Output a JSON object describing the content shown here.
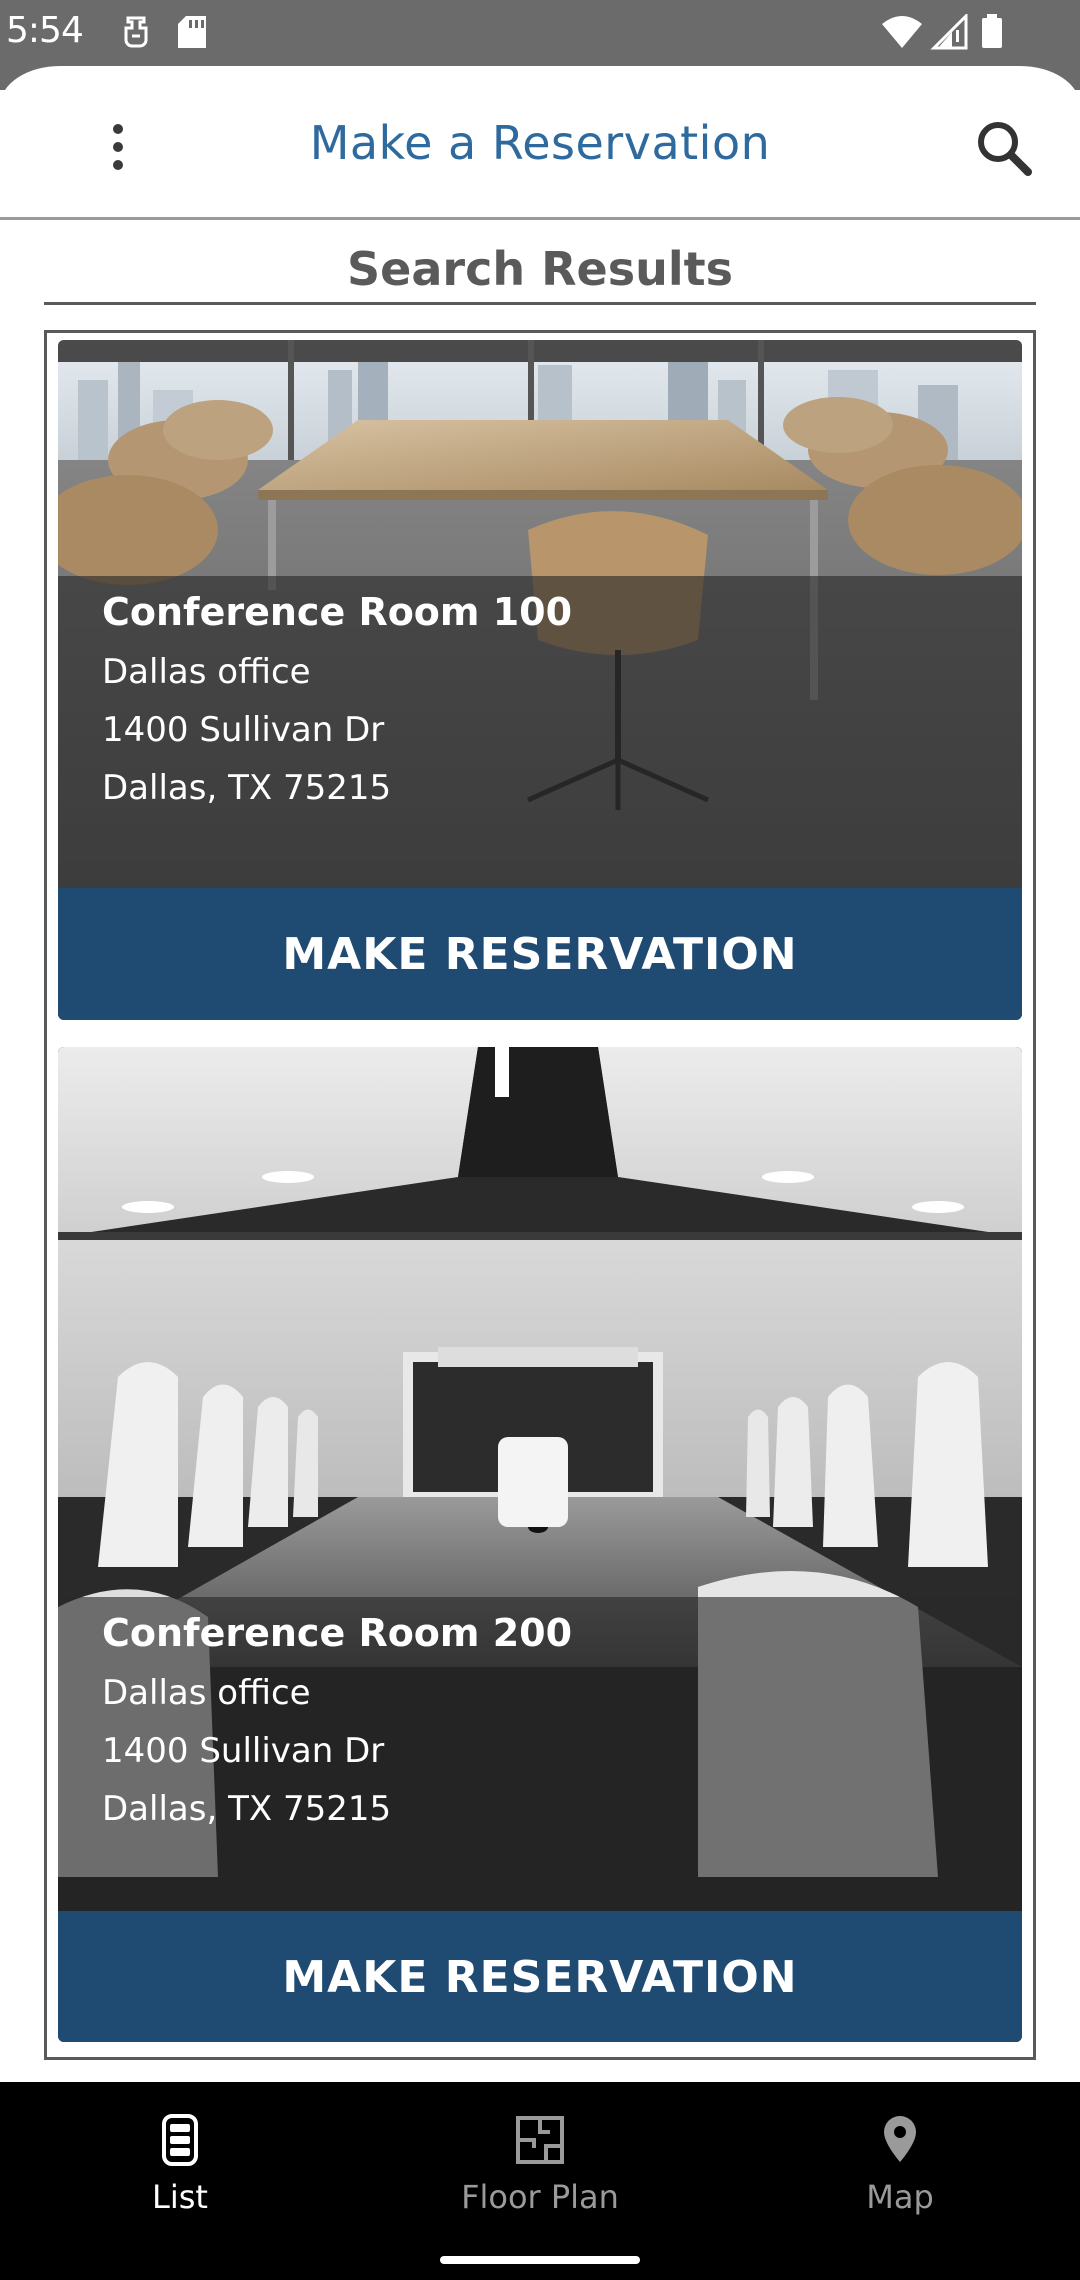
{
  "status_bar": {
    "time": "5:54"
  },
  "header": {
    "title": "Make a Reservation",
    "menu_icon": "more-vert-icon",
    "search_icon": "search-icon"
  },
  "results": {
    "title": "Search Results"
  },
  "rooms": [
    {
      "name": "Conference Room 100",
      "office": "Dallas office",
      "street": "1400 Sullivan Dr",
      "city": "Dallas, TX 75215",
      "button_label": "MAKE RESERVATION"
    },
    {
      "name": "Conference Room 200",
      "office": "Dallas office",
      "street": "1400 Sullivan Dr",
      "city": "Dallas, TX 75215",
      "button_label": "MAKE RESERVATION"
    }
  ],
  "bottom_nav": {
    "items": [
      {
        "label": "List",
        "icon": "list-icon",
        "active": true
      },
      {
        "label": "Floor Plan",
        "icon": "floor-plan-icon",
        "active": false
      },
      {
        "label": "Map",
        "icon": "map-pin-icon",
        "active": false
      }
    ]
  },
  "colors": {
    "accent_blue": "#2e6a9e",
    "button_blue": "#1f4a72",
    "nav_background": "#000000"
  }
}
